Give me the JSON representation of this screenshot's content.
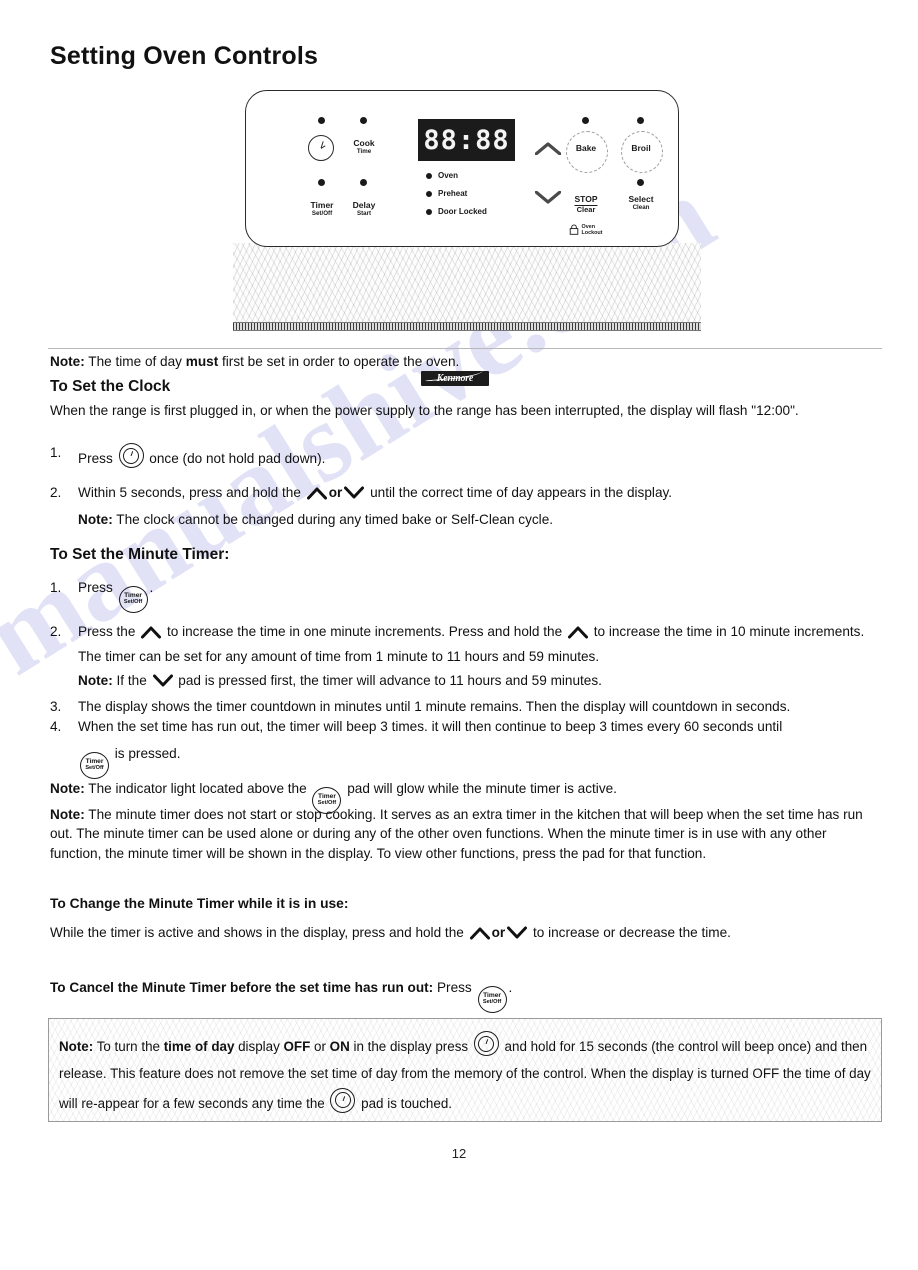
{
  "document": {
    "title": "Setting Oven Controls",
    "page_number": "12",
    "watermark": "manualshive.com"
  },
  "control_panel": {
    "display_value": "88:88",
    "brand": "Kenmore",
    "left_pads": [
      {
        "name": "clock",
        "label": "",
        "sub": ""
      },
      {
        "name": "cook-time",
        "label": "Cook",
        "sub": "Time"
      },
      {
        "name": "timer-set-off",
        "label": "Timer",
        "sub": "Set/Off"
      },
      {
        "name": "delay-start",
        "label": "Delay",
        "sub": "Start"
      }
    ],
    "status_indicators": [
      "Oven",
      "Preheat",
      "Door Locked"
    ],
    "right_pads": [
      {
        "name": "bake",
        "label": "Bake"
      },
      {
        "name": "broil",
        "label": "Broil"
      },
      {
        "name": "stop-clear",
        "label": "STOP",
        "sub": "Clear"
      },
      {
        "name": "select-clean",
        "label": "Select",
        "sub": "Clean"
      }
    ],
    "lockout_label_line1": "Oven",
    "lockout_label_line2": "Lockout"
  },
  "content": {
    "lead_note_bold": "Note:",
    "lead_note_pre": " The time of day ",
    "lead_note_strong": "must",
    "lead_note_post": " first be set in order to operate the oven.",
    "clock_heading": "To Set the Clock",
    "clock_intro": "When the range is first plugged in, or when the power supply to the range has been interrupted, the display will flash \"12:00\".",
    "clock_step1_num": "1.",
    "clock_step1_pre": "Press ",
    "clock_step1_post": " once (do not hold pad down).",
    "clock_step2_num": "2.",
    "clock_step2_pre": "Within 5 seconds, press and hold the ",
    "clock_step2_or": "or",
    "clock_step2_post": " until the correct time of day appears in the display.",
    "clock_note_bold": "Note:",
    "clock_note_text": " The clock cannot be changed during any timed bake or Self-Clean cycle.",
    "timer_heading": "To Set the Minute Timer:",
    "timer_step1_num": "1.",
    "timer_step1_pre": "Press ",
    "timer_step1_post": ".",
    "timer_step2_num": "2.",
    "timer_step2_a": "Press the ",
    "timer_step2_b": " to increase the time in one minute increments. Press and hold the ",
    "timer_step2_c": " to increase the time in 10 minute increments. The timer can be set for any amount of time from 1 minute to 11 hours and 59 minutes.",
    "timer_note1_bold": "Note:",
    "timer_note1_pre": " If the ",
    "timer_note1_post": " pad is pressed first, the timer will advance to 11 hours and 59 minutes.",
    "timer_step3_num": "3.",
    "timer_step3_text": "The display shows the timer countdown in minutes until 1 minute remains. Then the display will countdown in seconds.",
    "timer_step4_num": "4.",
    "timer_step4_text": "When the set time has run out, the timer will beep 3 times. it will then continue to beep 3 times every 60 seconds until",
    "timer_step4_post": " is pressed.",
    "timer_note2_bold": "Note:",
    "timer_note2_pre": " The indicator light located above the ",
    "timer_note2_post": " pad will glow while the minute timer is active.",
    "timer_note3_bold": "Note:",
    "timer_note3_text": " The minute timer does not start or stop cooking. It serves as an extra timer in the kitchen that will beep when the set time has run out. The minute timer can be used alone or during any of the other oven functions. When the minute timer is in use with any other function, the minute timer will be shown in the display. To view other functions, press the pad for that function.",
    "change_heading": "To Change the Minute Timer while it is in use:",
    "change_pre": "While the timer is active and shows in the display, press and hold the ",
    "change_or": "or",
    "change_post": " to increase or decrease the time.",
    "cancel_heading": "To Cancel the Minute Timer before the set time has run out:",
    "cancel_pre": " Press ",
    "cancel_post": ".",
    "box_note_bold": "Note:",
    "box_note_a": " To turn the ",
    "box_note_b": "time of day",
    "box_note_c": " display ",
    "box_note_d": "OFF",
    "box_note_e": " or ",
    "box_note_f": "ON",
    "box_note_g": " in the display press ",
    "box_note_h": " and hold for 15 seconds (the control will beep once) and then release. This feature does not remove the set time of day from the memory of the control. When the display is turned OFF the time of day will re-appear for a few seconds any time the ",
    "box_note_i": " pad is touched."
  },
  "colors": {
    "ink": "#111111",
    "panel_border": "#2a2a2a",
    "lcd_bg": "#1b1b1b",
    "lcd_fg": "#f4f4f4",
    "watermark": "#6e6ed7"
  }
}
